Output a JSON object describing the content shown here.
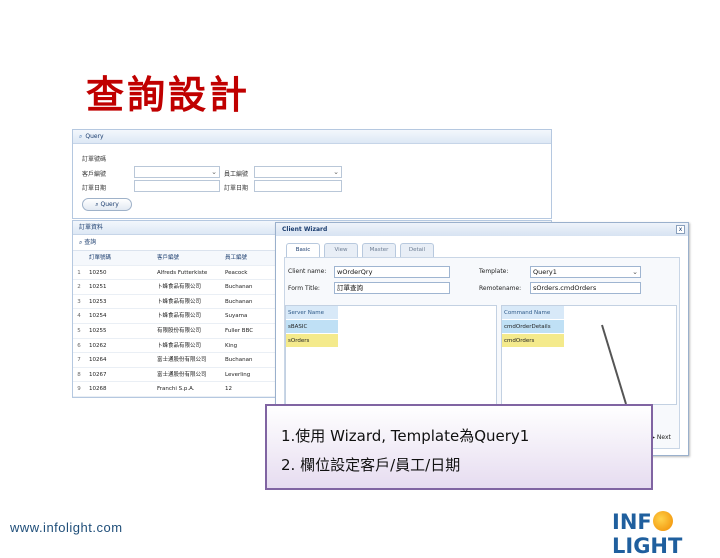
{
  "slide": {
    "title": "查詢設計",
    "footer_url": "www.infolight.com",
    "logo_left": "INF",
    "logo_right": "LIGHT"
  },
  "query_panel": {
    "title": "Query",
    "fields": [
      "訂單號碼",
      "客戶編號",
      "訂單日期"
    ],
    "field_right": [
      "員工編號",
      "訂單日期"
    ],
    "button": "Query"
  },
  "orders_panel": {
    "title": "訂單資料",
    "toolbar_query": "查詢",
    "columns": [
      "訂單號碼",
      "客戶編號",
      "員工編號"
    ],
    "rows": [
      [
        "1",
        "10250",
        "Alfreds Futterkiste",
        "Peacock"
      ],
      [
        "2",
        "10251",
        "卜蜂食品有限公司",
        "Buchanan"
      ],
      [
        "3",
        "10253",
        "卜蜂食品有限公司",
        "Buchanan"
      ],
      [
        "4",
        "10254",
        "卜蜂食品有限公司",
        "Suyama"
      ],
      [
        "5",
        "10255",
        "有限股份有限公司",
        "Fuller BBC"
      ],
      [
        "6",
        "10262",
        "卜蜂食品有限公司",
        "King"
      ],
      [
        "7",
        "10264",
        "富士通股份有限公司",
        "Buchanan"
      ],
      [
        "8",
        "10267",
        "富士通股份有限公司",
        "Leverling"
      ],
      [
        "9",
        "10268",
        "Franchi S.p.A.",
        "12"
      ]
    ]
  },
  "wizard": {
    "title": "Client Wizard",
    "close": "x",
    "tabs": [
      "Basic",
      "View",
      "Master",
      "Detail"
    ],
    "client_name_label": "Client name:",
    "client_name_value": "wOrderQry",
    "form_title_label": "Form Title:",
    "form_title_value": "訂單查詢",
    "template_label": "Template:",
    "template_value": "Query1",
    "remote_name_label": "Remotename:",
    "remote_name_value": "sOrders.cmdOrders",
    "left_list": [
      "Server Name",
      "sBASIC",
      "sOrders"
    ],
    "right_list": [
      "Command Name",
      "cmdOrderDetails",
      "cmdOrders"
    ],
    "next_label": "Next"
  },
  "note": {
    "line1": "1.使用 Wizard, Template為Query1",
    "line2": "2. 欄位設定客戶/員工/日期"
  }
}
